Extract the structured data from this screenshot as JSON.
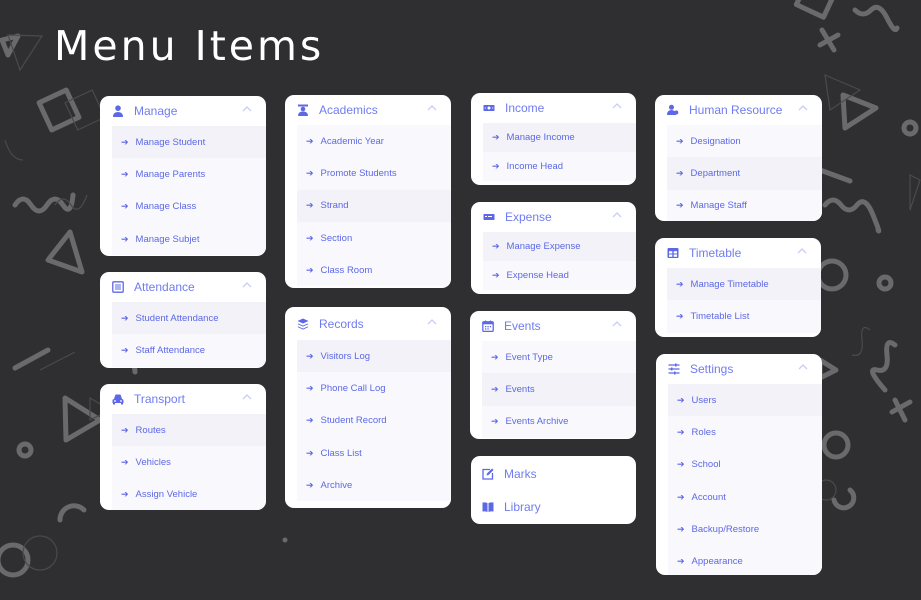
{
  "page": {
    "title": "Menu Items"
  },
  "colors": {
    "background": "#2f2f31",
    "accent": "#6f7cf0",
    "item_text": "#5c68e6",
    "active_row": "#f2f2f8"
  },
  "cards": {
    "manage": {
      "title": "Manage",
      "icon": "user-icon",
      "items": [
        "Manage Student",
        "Manage Parents",
        "Manage Class",
        "Manage Subjet"
      ]
    },
    "attendance": {
      "title": "Attendance",
      "icon": "list-icon",
      "items": [
        "Student Attendance",
        "Staff Attendance"
      ]
    },
    "transport": {
      "title": "Transport",
      "icon": "car-icon",
      "items": [
        "Routes",
        "Vehicles",
        "Assign Vehicle"
      ]
    },
    "academics": {
      "title": "Academics",
      "icon": "graduate-icon",
      "items": [
        "Academic Year",
        "Promote Students",
        "Strand",
        "Section",
        "Class Room"
      ]
    },
    "records": {
      "title": "Records",
      "icon": "layers-icon",
      "items": [
        "Visitors Log",
        "Phone Call Log",
        "Student Record",
        "Class List",
        "Archive"
      ]
    },
    "income": {
      "title": "Income",
      "icon": "money-icon",
      "items": [
        "Manage Income",
        "Income Head"
      ]
    },
    "expense": {
      "title": "Expense",
      "icon": "bill-icon",
      "items": [
        "Manage Expense",
        "Expense Head"
      ]
    },
    "events": {
      "title": "Events",
      "icon": "calendar-icon",
      "items": [
        "Event Type",
        "Events",
        "Events Archive"
      ]
    },
    "marks": {
      "title": "Marks",
      "icon": "edit-icon"
    },
    "library": {
      "title": "Library",
      "icon": "book-icon"
    },
    "human_resource": {
      "title": "Human Resource",
      "icon": "users-icon",
      "items": [
        "Designation",
        "Department",
        "Manage Staff"
      ]
    },
    "timetable": {
      "title": "Timetable",
      "icon": "table-icon",
      "items": [
        "Manage Timetable",
        "Timetable List"
      ]
    },
    "settings": {
      "title": "Settings",
      "icon": "sliders-icon",
      "items": [
        "Users",
        "Roles",
        "School",
        "Account",
        "Backup/Restore",
        "Appearance"
      ]
    }
  },
  "arrow_glyph": "➔"
}
